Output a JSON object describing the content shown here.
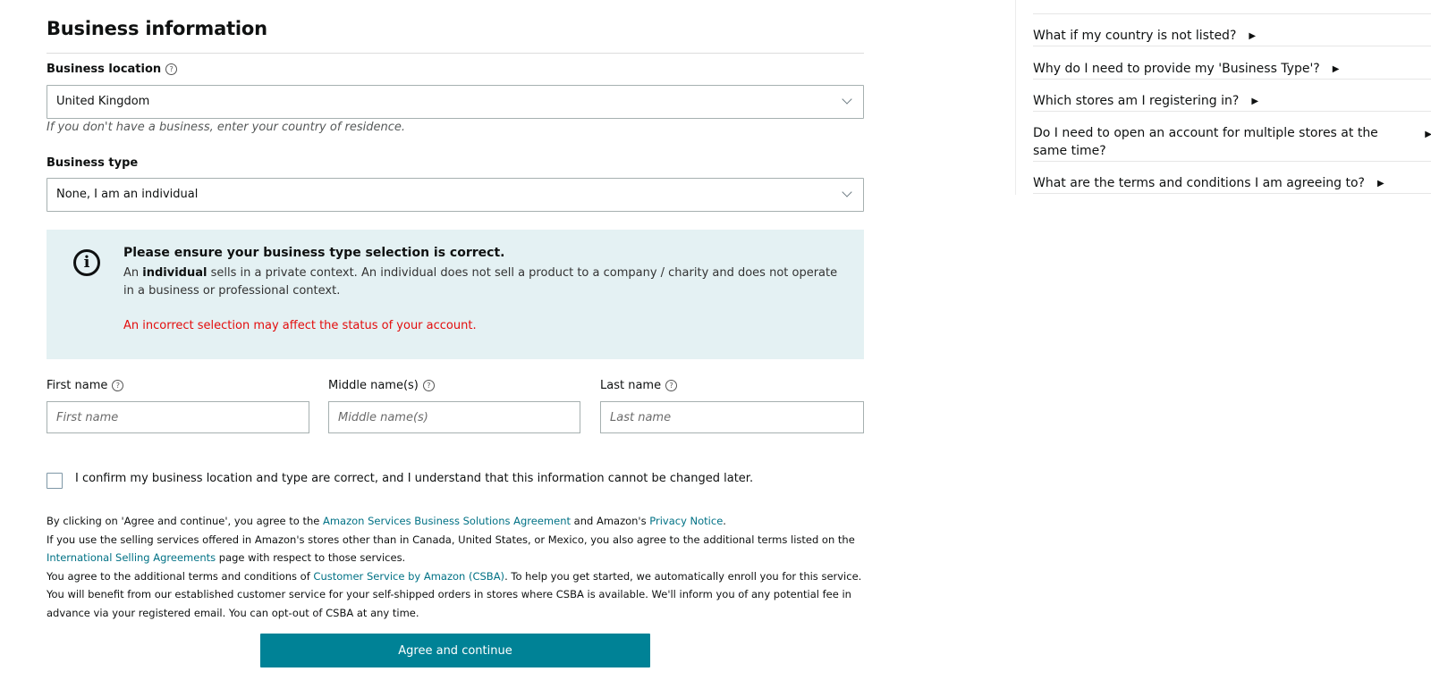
{
  "section": {
    "title": "Business information"
  },
  "business_location": {
    "label": "Business location",
    "help_icon": "question-circle-icon",
    "value": "United Kingdom",
    "hint": "If you don't have a business, enter your country of residence."
  },
  "business_type": {
    "label": "Business type",
    "value": "None, I am an individual"
  },
  "alert": {
    "icon": "info-icon",
    "title": "Please ensure your business type selection is correct.",
    "body_prefix": "An ",
    "body_bold": "individual",
    "body_rest": " sells in a private context. An individual does not sell a product to a company / charity and does not operate in a business or professional context.",
    "warning": "An incorrect selection may affect the status of your account.",
    "warning_color": "#e30d0d",
    "background": "#e4f1f3"
  },
  "name_fields": [
    {
      "label": "First name",
      "placeholder": "First name",
      "value": ""
    },
    {
      "label": "Middle name(s)",
      "placeholder": "Middle name(s)",
      "value": ""
    },
    {
      "label": "Last name",
      "placeholder": "Last name",
      "value": ""
    }
  ],
  "confirm": {
    "label": "I confirm my business location and type are correct, and I understand that this information cannot be changed later.",
    "checked": false
  },
  "legal": {
    "p1_a": "By clicking on 'Agree and continue', you agree to the ",
    "link_bsa": "Amazon Services Business Solutions Agreement",
    "p1_b": " and Amazon's ",
    "link_privacy": "Privacy Notice",
    "p1_c": ".",
    "p2_a": "If you use the selling services offered in Amazon's stores other than in Canada, United States, or Mexico, you also agree to the additional terms listed on the ",
    "link_isa": "International Selling Agreements",
    "p2_b": " page with respect to those services.",
    "p3_a": "You agree to the additional terms and conditions of ",
    "link_csba": "Customer Service by Amazon (CSBA)",
    "p3_b": ". To help you get started, we automatically enroll you for this service. You will benefit from our established customer service for your self-shipped orders in stores where CSBA is available. We'll inform you of any potential fee in advance via your registered email. You can opt-out of CSBA at any time.",
    "link_color": "#007185"
  },
  "cta": {
    "label": "Agree and continue",
    "color": "#008296"
  },
  "faq": {
    "items": [
      {
        "text": "What if my country is not listed?",
        "icon": "caret-right-icon"
      },
      {
        "text": "Why do I need to provide my 'Business Type'?",
        "icon": "caret-right-icon"
      },
      {
        "text": "Which stores am I registering in?",
        "icon": "caret-right-icon"
      },
      {
        "text": "Do I need to open an account for multiple stores at the same time?",
        "icon": "caret-right-icon"
      },
      {
        "text": "What are the terms and conditions I am agreeing to?",
        "icon": "caret-right-icon"
      }
    ]
  }
}
